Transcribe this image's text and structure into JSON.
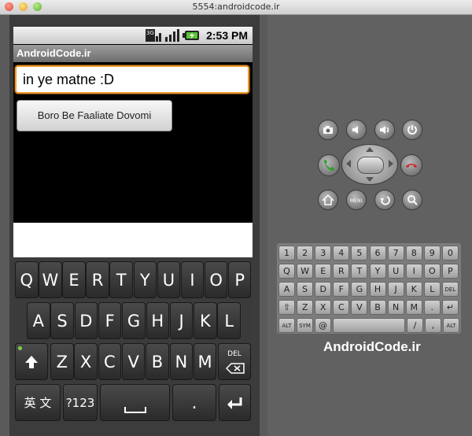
{
  "window": {
    "title": "5554:androidcode.ir"
  },
  "status_bar": {
    "time": "2:53 PM",
    "network": "3G"
  },
  "app": {
    "title": "AndroidCode.ir"
  },
  "text_field": {
    "value": "in ye matne :D"
  },
  "button": {
    "label": "Boro Be Faaliate Dovomi"
  },
  "soft_keyboard": {
    "row1": [
      "Q",
      "W",
      "E",
      "R",
      "T",
      "Y",
      "U",
      "I",
      "O",
      "P"
    ],
    "row2": [
      "A",
      "S",
      "D",
      "F",
      "G",
      "H",
      "J",
      "K",
      "L"
    ],
    "row3": [
      "Z",
      "X",
      "C",
      "V",
      "B",
      "N",
      "M"
    ],
    "delete_label": "DEL",
    "lang_label": "英 文",
    "sym_label": "?123",
    "period_label": "."
  },
  "hw_keyboard": {
    "row1": [
      "1",
      "2",
      "3",
      "4",
      "5",
      "6",
      "7",
      "8",
      "9",
      "0"
    ],
    "row2": [
      "Q",
      "W",
      "E",
      "R",
      "T",
      "Y",
      "U",
      "I",
      "O",
      "P"
    ],
    "row3": [
      "A",
      "S",
      "D",
      "F",
      "G",
      "H",
      "J",
      "K",
      "L",
      "DEL"
    ],
    "row4": [
      "⇧",
      "Z",
      "X",
      "C",
      "V",
      "B",
      "N",
      "M",
      ".",
      "↵"
    ],
    "alt_label": "ALT",
    "sym_label": "SYM",
    "at_label": "@",
    "slash_label": "/",
    "question_label": "?",
    "comma_label": ","
  },
  "brand": {
    "text": "AndroidCode.ir"
  },
  "colors": {
    "focus_border": "#f39a2c",
    "call_green": "#2aa12a",
    "end_red": "#d42020"
  }
}
